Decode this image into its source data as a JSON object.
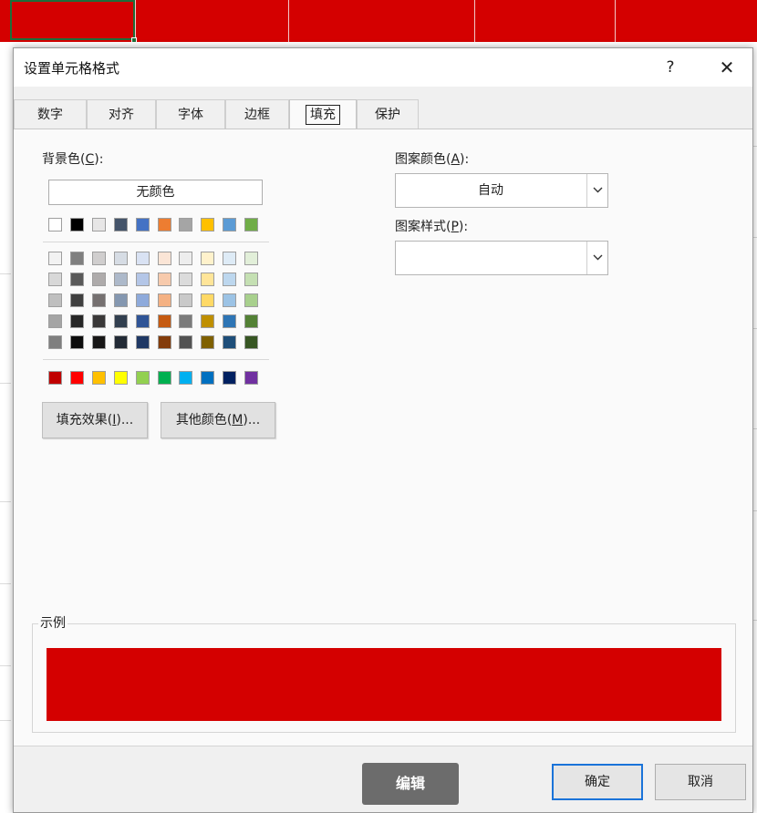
{
  "dialog": {
    "title": "设置单元格格式",
    "help_label": "?",
    "close_label": "✕"
  },
  "tabs": [
    {
      "label": "数字"
    },
    {
      "label": "对齐"
    },
    {
      "label": "字体"
    },
    {
      "label": "边框"
    },
    {
      "label": "填充",
      "active": true
    },
    {
      "label": "保护"
    }
  ],
  "fill": {
    "background_color_label": "背景色",
    "background_color_key": "C",
    "no_color_label": "无颜色",
    "theme_top_colors": [
      "#ffffff",
      "#000000",
      "#e7e6e6",
      "#44546a",
      "#4472c4",
      "#ed7d31",
      "#a5a5a5",
      "#ffc000",
      "#5b9bd5",
      "#70ad47"
    ],
    "theme_shades": [
      [
        "#f2f2f2",
        "#7f7f7f",
        "#d0cece",
        "#d6dce4",
        "#d9e2f3",
        "#fbe5d6",
        "#ededed",
        "#fff2cc",
        "#deebf6",
        "#e2efd9"
      ],
      [
        "#d8d8d8",
        "#595959",
        "#aeabab",
        "#adb9ca",
        "#b4c6e7",
        "#f7caac",
        "#dbdbdb",
        "#ffe599",
        "#bdd7ee",
        "#c5e0b3"
      ],
      [
        "#bfbfbf",
        "#3f3f3f",
        "#757070",
        "#8497b0",
        "#8eaadb",
        "#f4b183",
        "#c9c9c9",
        "#ffd966",
        "#9cc3e5",
        "#a8d08d"
      ],
      [
        "#a5a5a5",
        "#262626",
        "#3a3838",
        "#323f4f",
        "#2f5496",
        "#c55a11",
        "#7b7b7b",
        "#bf8f00",
        "#2e75b5",
        "#538135"
      ],
      [
        "#7f7f7f",
        "#0c0c0c",
        "#171616",
        "#222a35",
        "#1f3864",
        "#833c0b",
        "#525252",
        "#7f6000",
        "#1e4e79",
        "#375623"
      ]
    ],
    "standard_colors": [
      "#c00000",
      "#ff0000",
      "#ffc000",
      "#ffff00",
      "#92d050",
      "#00b050",
      "#00b0f0",
      "#0070c0",
      "#002060",
      "#7030a0"
    ],
    "fill_effects_label": "填充效果",
    "fill_effects_key": "I",
    "more_colors_label": "其他颜色",
    "more_colors_key": "M",
    "pattern_color_label": "图案颜色",
    "pattern_color_key": "A",
    "pattern_color_value": "自动",
    "pattern_style_label": "图案样式",
    "pattern_style_key": "P",
    "pattern_style_value": "",
    "sample_label": "示例",
    "sample_color": "#d40000"
  },
  "buttons": {
    "ok_label": "确定",
    "cancel_label": "取消",
    "edit_label": "编辑"
  },
  "sheet": {
    "fill_color": "#d40000"
  }
}
